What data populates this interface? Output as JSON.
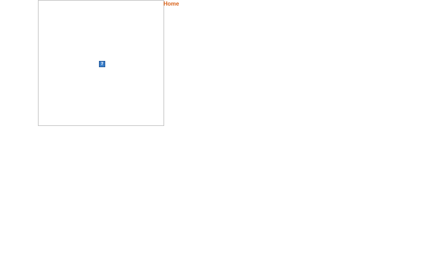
{
  "nav": {
    "home_label": "Home"
  },
  "image": {
    "icon": "broken-image-icon",
    "glyph": "?"
  },
  "colors": {
    "link": "#d9641c",
    "frame_border": "#c8c8c8",
    "icon_fill": "#3a7ec9"
  }
}
